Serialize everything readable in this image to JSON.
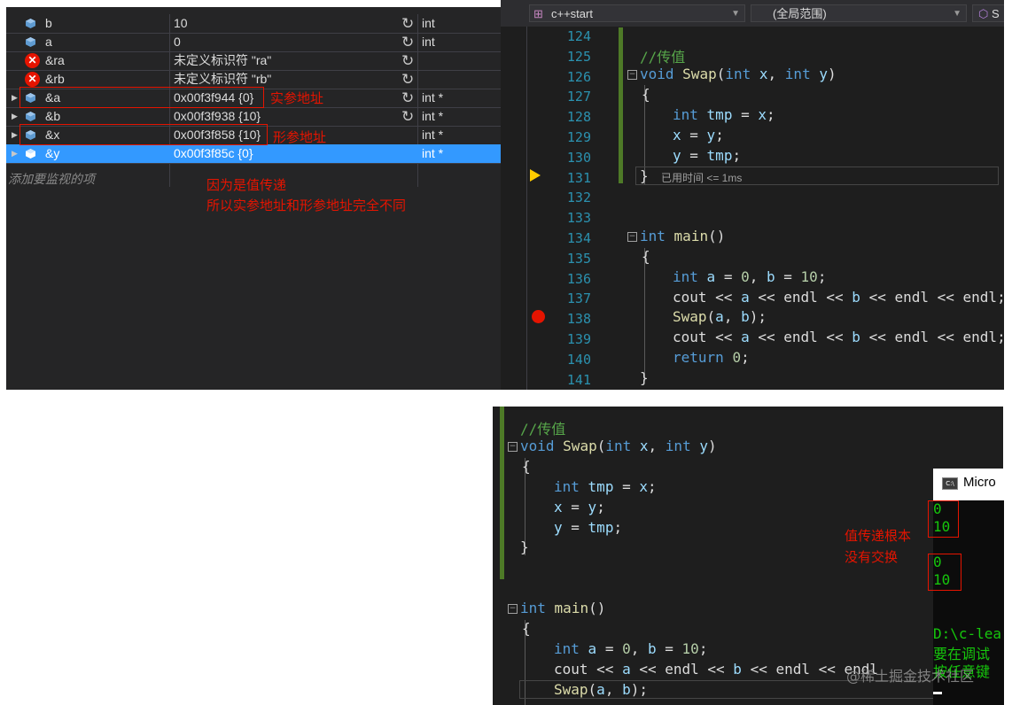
{
  "watch": {
    "add_watch_label": "添加要监视的项",
    "rows": [
      {
        "name": "b",
        "value": "10",
        "type": "int",
        "kind": "var",
        "expandable": false,
        "refresh": true
      },
      {
        "name": "a",
        "value": "0",
        "type": "int",
        "kind": "var",
        "expandable": false,
        "refresh": true
      },
      {
        "name": "&ra",
        "value": "未定义标识符 \"ra\"",
        "type": "",
        "kind": "error",
        "expandable": false,
        "refresh": true
      },
      {
        "name": "&rb",
        "value": "未定义标识符 \"rb\"",
        "type": "",
        "kind": "error",
        "expandable": false,
        "refresh": true
      },
      {
        "name": "&a",
        "value": "0x00f3f944 {0}",
        "type": "int *",
        "kind": "var",
        "expandable": true,
        "refresh": true
      },
      {
        "name": "&b",
        "value": "0x00f3f938 {10}",
        "type": "int *",
        "kind": "var",
        "expandable": true,
        "refresh": true
      },
      {
        "name": "&x",
        "value": "0x00f3f858 {10}",
        "type": "int *",
        "kind": "var",
        "expandable": true,
        "refresh": false
      },
      {
        "name": "&y",
        "value": "0x00f3f85c {0}",
        "type": "int *",
        "kind": "var",
        "expandable": true,
        "refresh": false,
        "selected": true
      }
    ],
    "annotations": {
      "actual_addr": "实参地址",
      "formal_addr": "形参地址",
      "reason_line1": "因为是值传递",
      "reason_line2": "所以实参地址和形参地址完全不同"
    }
  },
  "editor_top": {
    "project": "c++start",
    "scope": "(全局范围)",
    "cut_label": "S",
    "line_numbers": [
      "124",
      "125",
      "126",
      "127",
      "128",
      "129",
      "130",
      "131",
      "132",
      "133",
      "134",
      "135",
      "136",
      "137",
      "138",
      "139",
      "140",
      "141"
    ],
    "elapsed": "已用时间 <= 1ms",
    "code": {
      "comment": "//传值",
      "kw_void": "void",
      "fn_swap": "Swap",
      "kw_int": "int",
      "p_x": "x",
      "p_y": "y",
      "comma": ",",
      "lparen": "(",
      "rparen": ")",
      "brace_open": "{",
      "brace_close": "}",
      "tmp": "tmp",
      "assign": " = ",
      "semi": ";",
      "fn_main": "main",
      "paren_empty": "()",
      "a": "a",
      "b": "b",
      "zero": "0",
      "ten": "10",
      "cout": "cout",
      "shl": " << ",
      "endl": "endl",
      "kw_return": "return",
      "space": " ",
      "comma_space": ", "
    }
  },
  "console": {
    "title": "Micro",
    "out1": "0",
    "out2": "10",
    "out3": "0",
    "out4": "10",
    "path": "D:\\c-lea",
    "msg1": "要在调试",
    "msg2": "按任意键"
  },
  "bottom_annotation": {
    "line1": "值传递根本",
    "line2": "没有交换"
  },
  "watermark": "@稀土掘金技术社区"
}
